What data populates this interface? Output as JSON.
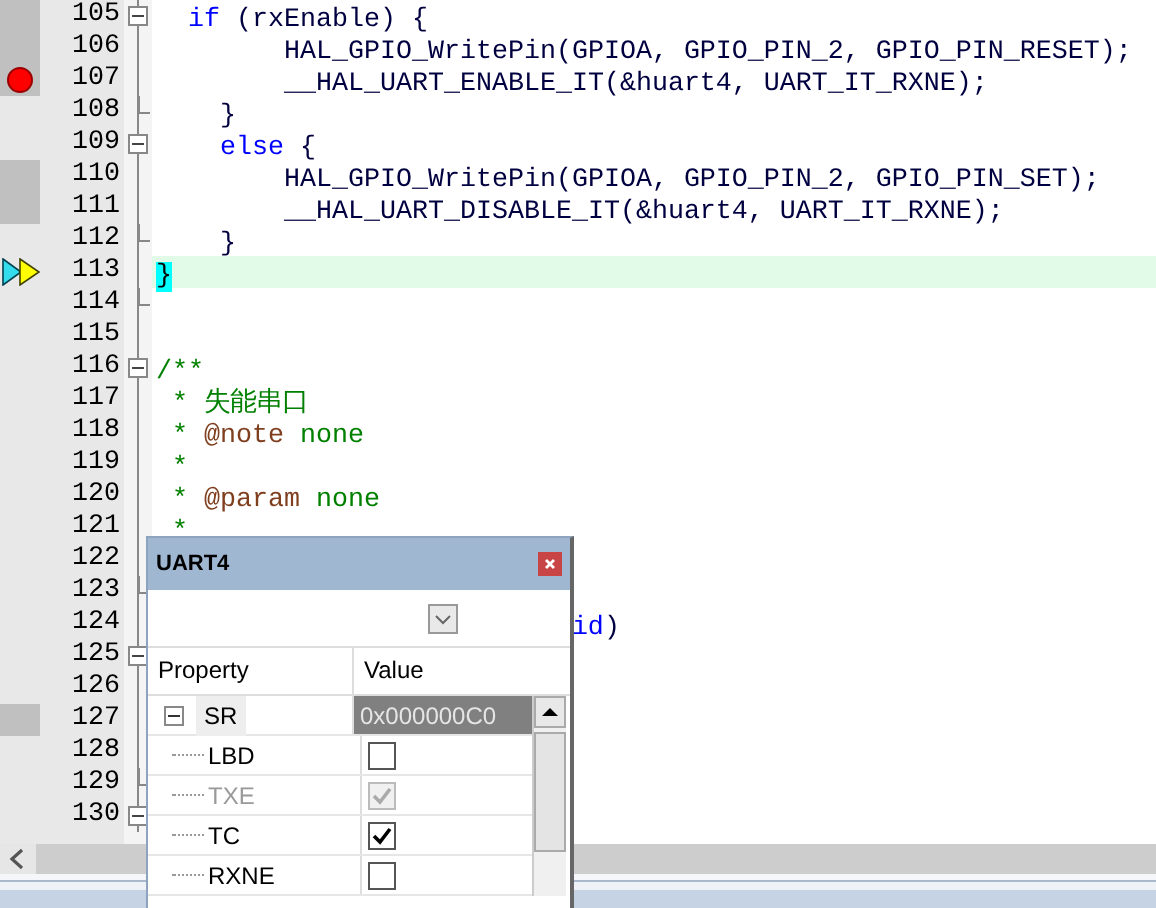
{
  "editor": {
    "lines": [
      {
        "number": "105",
        "covered": true,
        "breakpoint": false,
        "current": false,
        "fold_start": true,
        "fold_end": false,
        "highlighted": false,
        "code": [
          {
            "kind": "keyword",
            "text": "  if"
          },
          {
            "kind": "plain",
            "text": " (rxEnable) {"
          }
        ]
      },
      {
        "number": "106",
        "covered": true,
        "breakpoint": false,
        "current": false,
        "fold_start": false,
        "fold_end": false,
        "highlighted": false,
        "code": [
          {
            "kind": "plain",
            "text": "        HAL_GPIO_WritePin(GPIOA, GPIO_PIN_2, GPIO_PIN_RESET);"
          }
        ]
      },
      {
        "number": "107",
        "covered": true,
        "breakpoint": true,
        "current": false,
        "fold_start": false,
        "fold_end": false,
        "highlighted": false,
        "code": [
          {
            "kind": "plain",
            "text": "        __HAL_UART_ENABLE_IT(&huart4, UART_IT_RXNE);"
          }
        ]
      },
      {
        "number": "108",
        "covered": false,
        "breakpoint": false,
        "current": false,
        "fold_start": false,
        "fold_end": true,
        "highlighted": false,
        "code": [
          {
            "kind": "plain",
            "text": "    }"
          }
        ]
      },
      {
        "number": "109",
        "covered": false,
        "breakpoint": false,
        "current": false,
        "fold_start": true,
        "fold_end": false,
        "highlighted": false,
        "code": [
          {
            "kind": "keyword",
            "text": "    else"
          },
          {
            "kind": "plain",
            "text": " {"
          }
        ]
      },
      {
        "number": "110",
        "covered": true,
        "breakpoint": false,
        "current": false,
        "fold_start": false,
        "fold_end": false,
        "highlighted": false,
        "code": [
          {
            "kind": "plain",
            "text": "        HAL_GPIO_WritePin(GPIOA, GPIO_PIN_2, GPIO_PIN_SET);"
          }
        ]
      },
      {
        "number": "111",
        "covered": true,
        "breakpoint": false,
        "current": false,
        "fold_start": false,
        "fold_end": false,
        "highlighted": false,
        "code": [
          {
            "kind": "plain",
            "text": "        __HAL_UART_DISABLE_IT(&huart4, UART_IT_RXNE);"
          }
        ]
      },
      {
        "number": "112",
        "covered": false,
        "breakpoint": false,
        "current": false,
        "fold_start": false,
        "fold_end": true,
        "highlighted": false,
        "code": [
          {
            "kind": "plain",
            "text": "    }"
          }
        ]
      },
      {
        "number": "113",
        "covered": false,
        "breakpoint": false,
        "current": true,
        "fold_start": false,
        "fold_end": false,
        "highlighted": true,
        "code": [
          {
            "kind": "brace-match",
            "text": "}"
          }
        ]
      },
      {
        "number": "114",
        "covered": false,
        "breakpoint": false,
        "current": false,
        "fold_start": false,
        "fold_end": true,
        "highlighted": false
      },
      {
        "number": "115",
        "covered": false,
        "breakpoint": false,
        "current": false,
        "fold_start": false,
        "fold_end": false,
        "highlighted": false
      },
      {
        "number": "116",
        "covered": false,
        "breakpoint": false,
        "current": false,
        "fold_start": true,
        "fold_end": false,
        "highlighted": false,
        "code": [
          {
            "kind": "comment",
            "text": "/**"
          }
        ]
      },
      {
        "number": "117",
        "covered": false,
        "breakpoint": false,
        "current": false,
        "fold_start": false,
        "fold_end": false,
        "highlighted": false,
        "code": [
          {
            "kind": "comment",
            "text": " * 失能串口"
          }
        ]
      },
      {
        "number": "118",
        "covered": false,
        "breakpoint": false,
        "current": false,
        "fold_start": false,
        "fold_end": false,
        "highlighted": false,
        "code": [
          {
            "kind": "comment",
            "text": " * "
          },
          {
            "kind": "doctag",
            "text": "@note"
          },
          {
            "kind": "comment",
            "text": " none"
          }
        ]
      },
      {
        "number": "119",
        "covered": false,
        "breakpoint": false,
        "current": false,
        "fold_start": false,
        "fold_end": false,
        "highlighted": false,
        "code": [
          {
            "kind": "comment",
            "text": " *"
          }
        ]
      },
      {
        "number": "120",
        "covered": false,
        "breakpoint": false,
        "current": false,
        "fold_start": false,
        "fold_end": false,
        "highlighted": false,
        "code": [
          {
            "kind": "comment",
            "text": " * "
          },
          {
            "kind": "doctag",
            "text": "@param"
          },
          {
            "kind": "comment",
            "text": " none"
          }
        ]
      },
      {
        "number": "121",
        "covered": false,
        "breakpoint": false,
        "current": false,
        "fold_start": false,
        "fold_end": false,
        "highlighted": false,
        "code": [
          {
            "kind": "comment",
            "text": " *"
          }
        ]
      },
      {
        "number": "122",
        "covered": false,
        "breakpoint": false,
        "current": false,
        "fold_start": false,
        "fold_end": false,
        "highlighted": false
      },
      {
        "number": "123",
        "covered": false,
        "breakpoint": false,
        "current": false,
        "fold_start": false,
        "fold_end": true,
        "highlighted": false
      },
      {
        "number": "124",
        "covered": false,
        "breakpoint": false,
        "current": false,
        "fold_start": false,
        "fold_end": false,
        "highlighted": false,
        "code": [
          {
            "kind": "keyword",
            "text": "                          id"
          },
          {
            "kind": "plain",
            "text": ")"
          }
        ]
      },
      {
        "number": "125",
        "covered": false,
        "breakpoint": false,
        "current": false,
        "fold_start": true,
        "fold_end": false,
        "highlighted": false
      },
      {
        "number": "126",
        "covered": false,
        "breakpoint": false,
        "current": false,
        "fold_start": false,
        "fold_end": false,
        "highlighted": false
      },
      {
        "number": "127",
        "covered": true,
        "breakpoint": false,
        "current": false,
        "fold_start": false,
        "fold_end": false,
        "highlighted": false
      },
      {
        "number": "128",
        "covered": false,
        "breakpoint": false,
        "current": false,
        "fold_start": false,
        "fold_end": false,
        "highlighted": false
      },
      {
        "number": "129",
        "covered": false,
        "breakpoint": false,
        "current": false,
        "fold_start": false,
        "fold_end": true,
        "highlighted": false
      },
      {
        "number": "130",
        "covered": false,
        "breakpoint": false,
        "current": false,
        "fold_start": true,
        "fold_end": false,
        "highlighted": false
      }
    ]
  },
  "panel": {
    "title": "UART4",
    "columns": [
      "Property",
      "Value"
    ],
    "rows": [
      {
        "name": "SR",
        "expanded": true,
        "selected": true,
        "value": "0x000000C0",
        "children": [
          {
            "name": "LBD",
            "checked": false,
            "disabled": false
          },
          {
            "name": "TXE",
            "checked": true,
            "disabled": true
          },
          {
            "name": "TC",
            "checked": true,
            "disabled": false
          },
          {
            "name": "RXNE",
            "checked": false,
            "disabled": false
          }
        ]
      }
    ]
  }
}
